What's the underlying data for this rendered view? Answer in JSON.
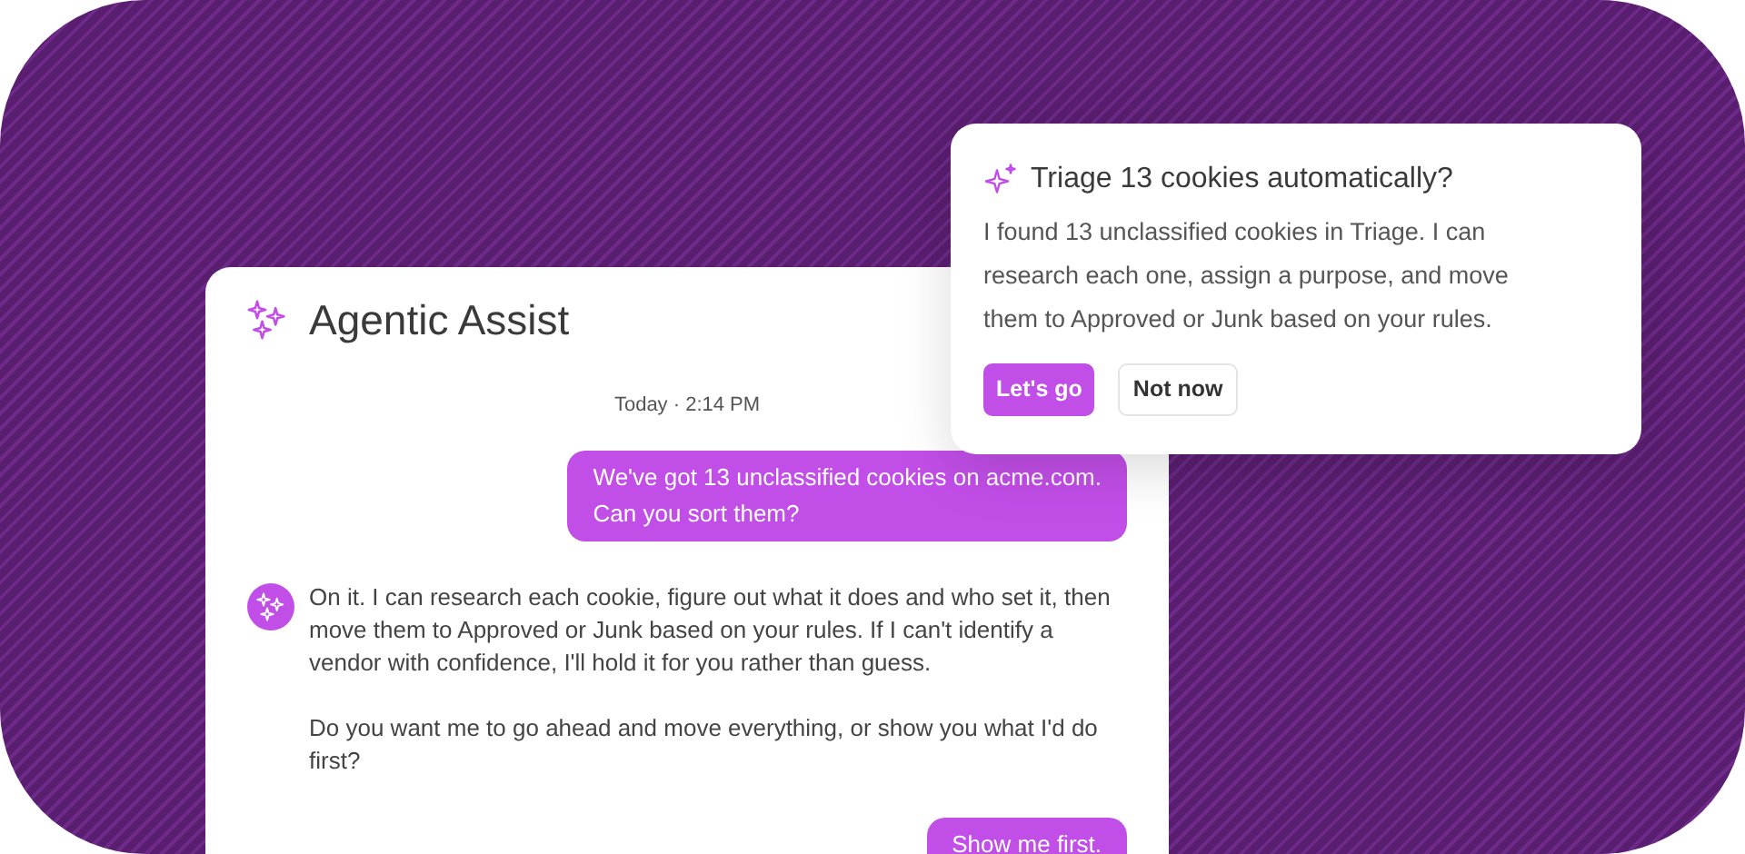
{
  "chat": {
    "title": "Agentic Assist",
    "timestamp": "Today · 2:14 PM",
    "messages": [
      {
        "kind": "user",
        "text": "We've got 13 unclassified cookies on acme.com.\nCan you sort them?"
      },
      {
        "kind": "assistant",
        "paragraphs": [
          "On it. I can research each cookie, figure out what it does and who set it, then move them to Approved or Junk based on your rules. If I can't identify a vendor with confidence, I'll hold it for you rather than guess.",
          "Do you want me to go ahead and move everything, or show you what I'd do first?"
        ]
      },
      {
        "kind": "user",
        "text": "Show me first."
      }
    ]
  },
  "prompt": {
    "title": "Triage 13 cookies automatically?",
    "body": "I found 13 unclassified cookies in Triage. I can research each one, assign a purpose, and move them to Approved or Junk based on your rules.",
    "buttons": [
      {
        "kind": "primary",
        "label": "Let's go"
      },
      {
        "kind": "secondary",
        "label": "Not now"
      }
    ]
  }
}
